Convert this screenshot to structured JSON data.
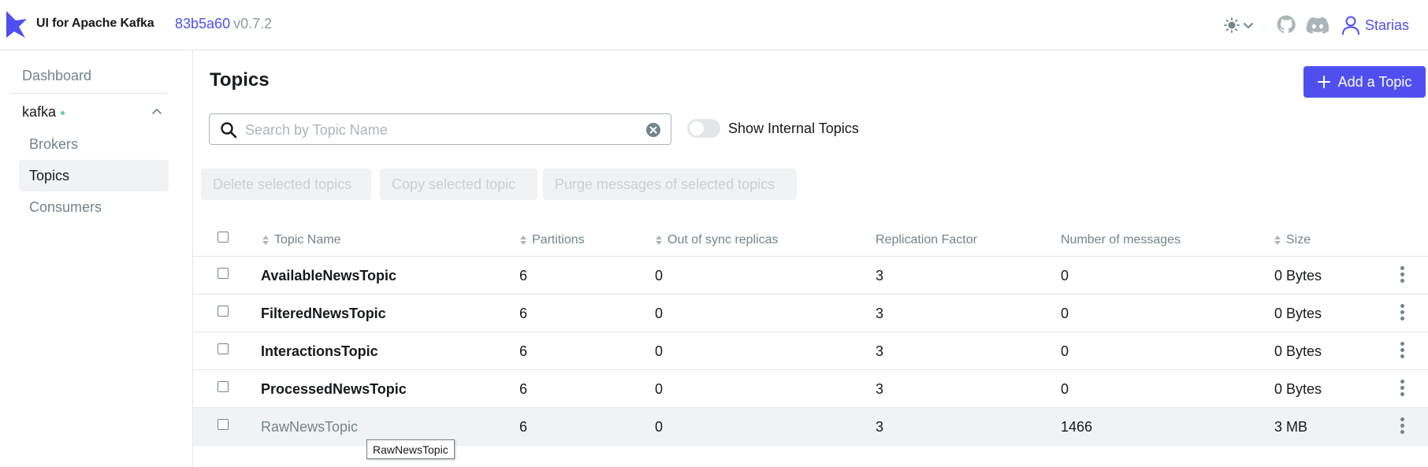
{
  "header": {
    "app_title": "UI for Apache Kafka",
    "commit": "83b5a60",
    "version": "v0.7.2",
    "user_name": "Starias"
  },
  "sidebar": {
    "dashboard": "Dashboard",
    "cluster_name": "kafka",
    "items": [
      {
        "label": "Brokers"
      },
      {
        "label": "Topics"
      },
      {
        "label": "Consumers"
      }
    ]
  },
  "main": {
    "title": "Topics",
    "add_button": "Add a Topic",
    "search_placeholder": "Search by Topic Name",
    "search_value": "",
    "toggle_label": "Show Internal Topics",
    "bulk_actions": {
      "delete": "Delete selected topics",
      "copy": "Copy selected topic",
      "purge": "Purge messages of selected topics"
    }
  },
  "table": {
    "columns": {
      "name": "Topic Name",
      "partitions": "Partitions",
      "out_of_sync": "Out of sync replicas",
      "replication": "Replication Factor",
      "messages": "Number of messages",
      "size": "Size"
    },
    "rows": [
      {
        "name": "AvailableNewsTopic",
        "partitions": "6",
        "out_of_sync": "0",
        "replication": "3",
        "messages": "0",
        "size": "0 Bytes"
      },
      {
        "name": "FilteredNewsTopic",
        "partitions": "6",
        "out_of_sync": "0",
        "replication": "3",
        "messages": "0",
        "size": "0 Bytes"
      },
      {
        "name": "InteractionsTopic",
        "partitions": "6",
        "out_of_sync": "0",
        "replication": "3",
        "messages": "0",
        "size": "0 Bytes"
      },
      {
        "name": "ProcessedNewsTopic",
        "partitions": "6",
        "out_of_sync": "0",
        "replication": "3",
        "messages": "0",
        "size": "0 Bytes"
      },
      {
        "name": "RawNewsTopic",
        "partitions": "6",
        "out_of_sync": "0",
        "replication": "3",
        "messages": "1466",
        "size": "3 MB"
      }
    ]
  },
  "tooltip": "RawNewsTopic",
  "colors": {
    "accent": "#4f4ff0",
    "muted": "#73848c",
    "online": "#5cd685"
  }
}
